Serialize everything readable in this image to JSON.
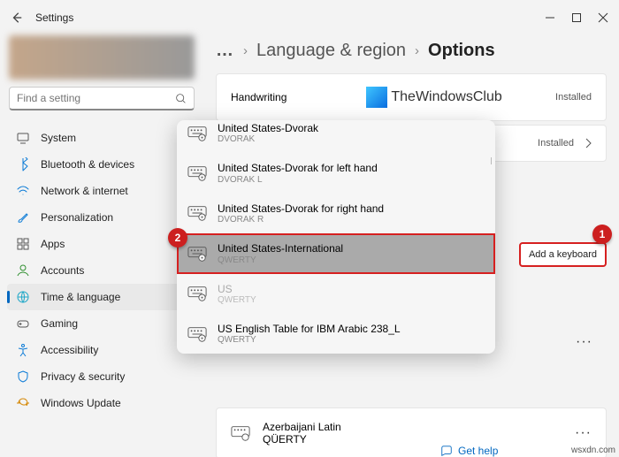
{
  "window": {
    "title": "Settings"
  },
  "search": {
    "placeholder": "Find a setting"
  },
  "sidebar": {
    "items": [
      {
        "label": "System",
        "icon": "system-icon",
        "color": "#555"
      },
      {
        "label": "Bluetooth & devices",
        "icon": "bluetooth-icon",
        "color": "#0a7ad6"
      },
      {
        "label": "Network & internet",
        "icon": "wifi-icon",
        "color": "#0a7ad6"
      },
      {
        "label": "Personalization",
        "icon": "brush-icon",
        "color": "#0a7ad6"
      },
      {
        "label": "Apps",
        "icon": "apps-icon",
        "color": "#555"
      },
      {
        "label": "Accounts",
        "icon": "account-icon",
        "color": "#2f8f2f"
      },
      {
        "label": "Time & language",
        "icon": "globe-icon",
        "color": "#20a8c8",
        "active": true
      },
      {
        "label": "Gaming",
        "icon": "gaming-icon",
        "color": "#555"
      },
      {
        "label": "Accessibility",
        "icon": "accessibility-icon",
        "color": "#0a7ad6"
      },
      {
        "label": "Privacy & security",
        "icon": "shield-icon",
        "color": "#0a7ad6"
      },
      {
        "label": "Windows Update",
        "icon": "update-icon",
        "color": "#d68a0a"
      }
    ]
  },
  "breadcrumb": {
    "ellipsis": "…",
    "a": "Language & region",
    "b": "Options"
  },
  "cards": {
    "handwriting": {
      "label": "Handwriting",
      "status": "Installed"
    },
    "hidden": {
      "status": "Installed"
    }
  },
  "logo": {
    "text": "TheWindowsClub"
  },
  "addkb": {
    "label": "Add a keyboard"
  },
  "bubbles": {
    "b1": "1",
    "b2": "2"
  },
  "popup": {
    "items": [
      {
        "name": "United States-Dvorak",
        "sub": "DVORAK",
        "cut": true
      },
      {
        "name": "United States-Dvorak for left hand",
        "sub": "DVORAK L"
      },
      {
        "name": "United States-Dvorak for right hand",
        "sub": "DVORAK R"
      },
      {
        "name": "United States-International",
        "sub": "QWERTY",
        "sel": true
      },
      {
        "name": "US",
        "sub": "QWERTY",
        "dis": true
      },
      {
        "name": "US English Table for IBM Arabic 238_L",
        "sub": "QWERTY"
      }
    ]
  },
  "after": {
    "name": "Azerbaijani Latin",
    "sub": "QÜERTY",
    "more": "···"
  },
  "help": {
    "label": "Get help"
  },
  "watermark": "wsxdn.com"
}
